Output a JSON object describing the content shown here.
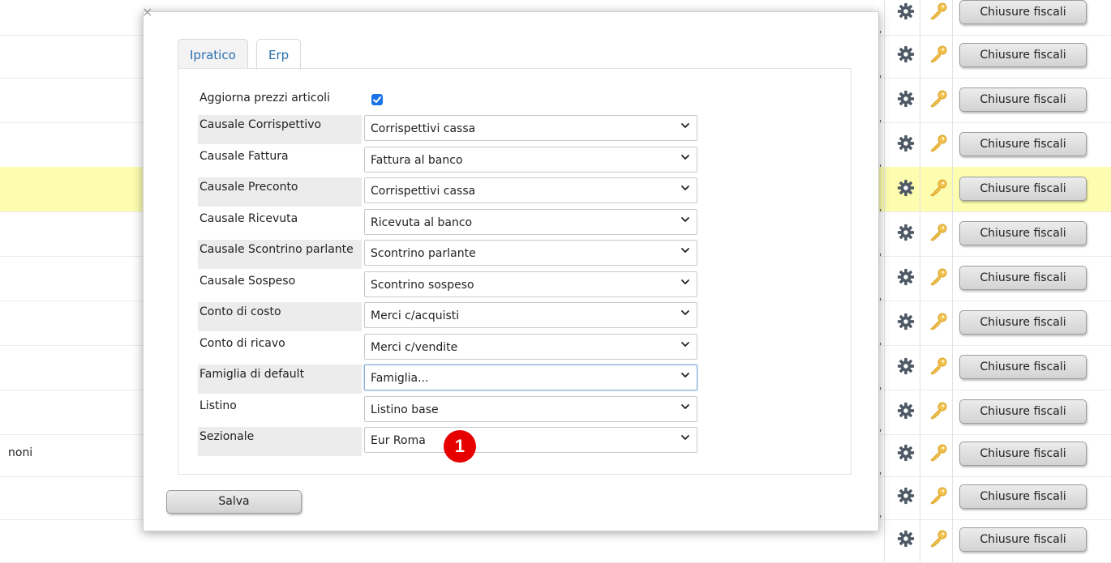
{
  "background": {
    "row_texts": [
      "",
      "",
      "",
      "",
      "",
      "",
      "",
      "",
      "",
      "",
      "noni",
      "",
      ""
    ],
    "action_label": "Chiusure fiscali"
  },
  "modal": {
    "close_symbol": "×",
    "tabs": [
      {
        "label": "Ipratico",
        "active": false
      },
      {
        "label": "Erp",
        "active": true
      }
    ],
    "checkbox_field": {
      "label": "Aggiorna prezzi articoli",
      "checked": true
    },
    "fields": [
      {
        "label": "Causale Corrispettivo",
        "value": "Corrispettivi cassa"
      },
      {
        "label": "Causale Fattura",
        "value": "Fattura al banco"
      },
      {
        "label": "Causale Preconto",
        "value": "Corrispettivi cassa"
      },
      {
        "label": "Causale Ricevuta",
        "value": "Ricevuta al banco"
      },
      {
        "label": "Causale Scontrino parlante",
        "value": "Scontrino parlante"
      },
      {
        "label": "Causale Sospeso",
        "value": "Scontrino sospeso"
      },
      {
        "label": "Conto di costo",
        "value": "Merci c/acquisti"
      },
      {
        "label": "Conto di ricavo",
        "value": "Merci c/vendite"
      },
      {
        "label": "Famiglia di default",
        "value": "Famiglia..."
      },
      {
        "label": "Listino",
        "value": "Listino base"
      },
      {
        "label": "Sezionale",
        "value": "Eur Roma"
      }
    ],
    "save_label": "Salva"
  },
  "annotation": {
    "number": "1",
    "color": "#e60000"
  },
  "colors": {
    "highlight_row": "#fdfdb0",
    "tab_text": "#2a6fb0",
    "checkbox": "#1a73e8"
  },
  "icons": [
    "gear-icon",
    "key-icon",
    "chevron-down-icon",
    "checkmark-icon",
    "close-icon"
  ]
}
